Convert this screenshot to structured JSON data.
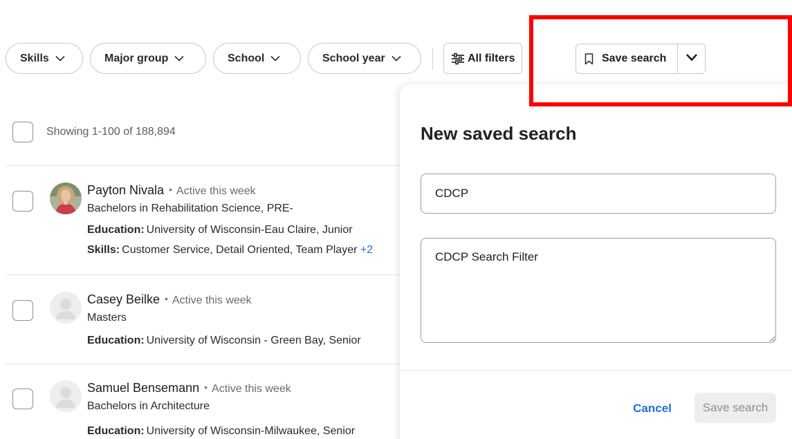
{
  "filters": {
    "skills": "Skills",
    "major_group": "Major group",
    "school": "School",
    "school_year": "School year",
    "all_filters": "All filters"
  },
  "save_search": {
    "label": "Save search"
  },
  "results": {
    "count_text": "Showing 1-100 of 188,894",
    "students": [
      {
        "name": "Payton Nivala",
        "status": "Active this week",
        "degree": "Bachelors in Rehabilitation Science, PRE-",
        "education_label": "Education:",
        "education": "University of Wisconsin-Eau Claire, Junior",
        "skills_label": "Skills:",
        "skills": "Customer Service, Detail Oriented, Team Player",
        "skills_more": "+2"
      },
      {
        "name": "Casey Beilke",
        "status": "Active this week",
        "degree": "Masters",
        "education_label": "Education:",
        "education": "University of Wisconsin - Green Bay, Senior"
      },
      {
        "name": "Samuel Bensemann",
        "status": "Active this week",
        "degree": "Bachelors in Architecture",
        "education_label": "Education:",
        "education": "University of Wisconsin-Milwaukee, Senior"
      }
    ]
  },
  "panel": {
    "title": "New saved search",
    "name_value": "CDCP",
    "description_value": "CDCP Search Filter",
    "cancel": "Cancel",
    "save": "Save search"
  },
  "colors": {
    "highlight": "#ff0000",
    "link_blue": "#1f6fe0"
  }
}
